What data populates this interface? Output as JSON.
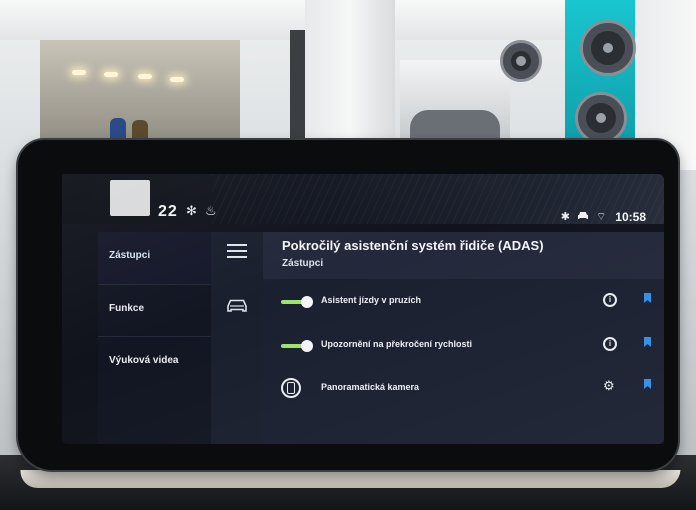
{
  "status_bar": {
    "temperature": "22",
    "fan_icon": "fan-icon",
    "seat_icon": "seat-heating-icon",
    "icons": [
      "bluetooth-icon",
      "car-icon",
      "signal-icon"
    ],
    "time": "10:58"
  },
  "sidebar": {
    "items": [
      {
        "label": "Zástupci",
        "active": true
      },
      {
        "label": "Funkce",
        "active": false
      },
      {
        "label": "Výuková videa",
        "active": false
      }
    ]
  },
  "icon_column": {
    "icons": [
      "menu-icon",
      "car-icon"
    ]
  },
  "content": {
    "title": "Pokročilý asistenční systém řidiče (ADAS)",
    "subtitle": "Zástupci",
    "rows": [
      {
        "label": "Asistent jízdy v pruzích",
        "control": "toggle-on",
        "action": "info-icon"
      },
      {
        "label": "Upozornění na překročení rychlosti",
        "control": "toggle-on",
        "action": "info-icon"
      },
      {
        "label": "Panoramatická kamera",
        "control": "camera-icon",
        "action": "gear-icon"
      }
    ]
  },
  "colors": {
    "toggle_on": "#9de36f",
    "bookmark": "#2f8fe6",
    "screen_bg": "#1a2030"
  }
}
